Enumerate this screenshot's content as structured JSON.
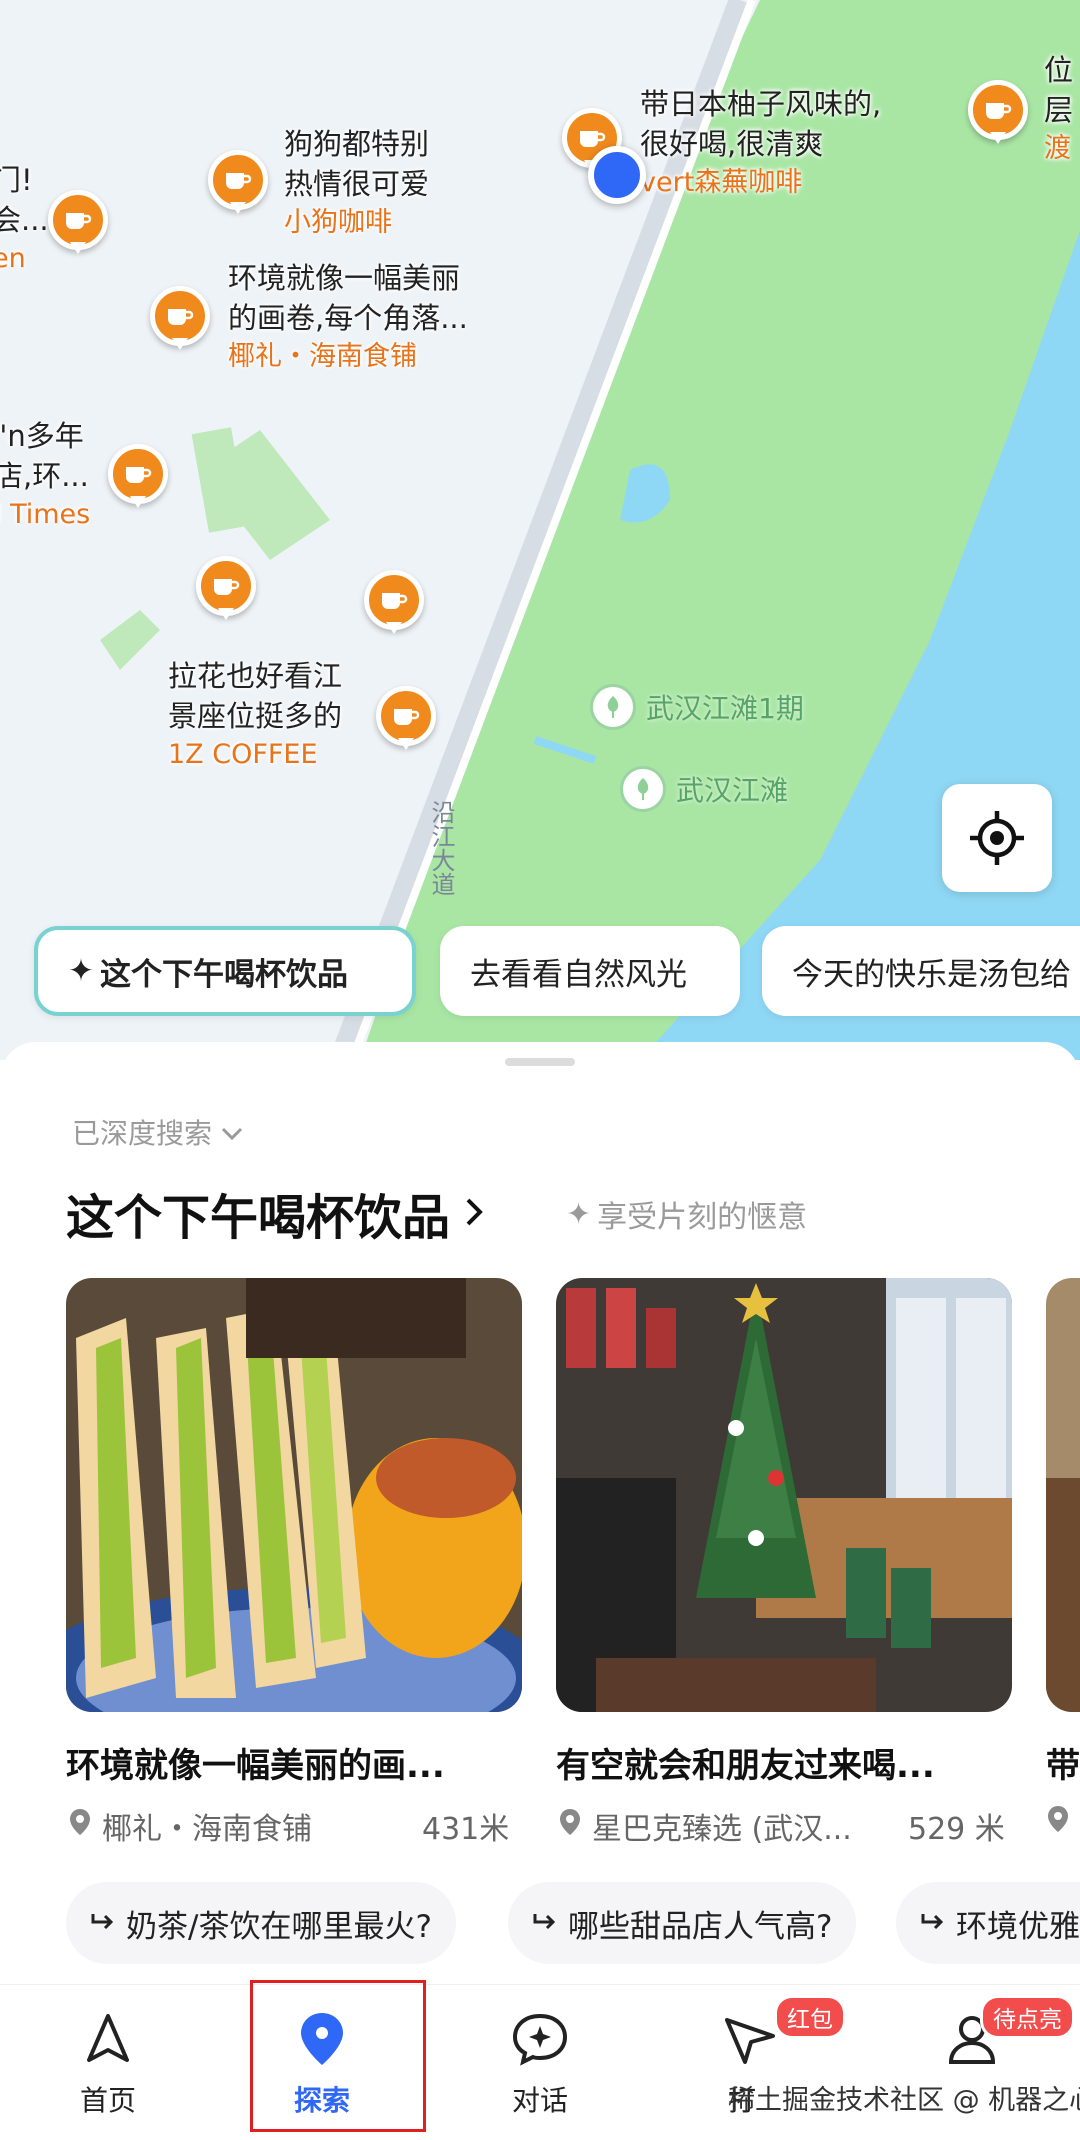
{
  "map": {
    "pois": [
      {
        "snippet": [
          "门!",
          "会..."
        ],
        "name": "en"
      },
      {
        "snippet": [
          "狗狗都特别",
          "热情很可爱"
        ],
        "name": "小狗咖啡"
      },
      {
        "snippet": [
          "带日本柚子风味的,",
          "很好喝,很清爽"
        ],
        "name": "vert森蕪咖啡"
      },
      {
        "snippet": [
          "位",
          "层"
        ],
        "name": "渡"
      },
      {
        "snippet": [
          "环境就像一幅美丽",
          "的画卷,每个角落..."
        ],
        "name": "椰礼・海南食铺"
      },
      {
        "snippet": [
          "\"n多年",
          "店,环..."
        ],
        "name": "l Times"
      },
      {
        "snippet": [
          "拉花也好看江",
          "景座位挺多的"
        ],
        "name": "1Z COFFEE"
      }
    ],
    "park_labels": [
      "武汉江滩1期",
      "武汉江滩"
    ],
    "road_label": "沿江大道",
    "chips": [
      "这个下午喝杯饮品",
      "去看看自然风光",
      "今天的快乐是汤包给"
    ]
  },
  "sheet": {
    "deep_search": "已深度搜索",
    "title": "这个下午喝杯饮品",
    "subtitle": "享受片刻的惬意",
    "cards": [
      {
        "title": "环境就像一幅美丽的画...",
        "place": "椰礼・海南食铺",
        "distance": "431米"
      },
      {
        "title": "有空就会和朋友过来喝...",
        "place": "星巴克臻选 (武汉...",
        "distance": "529 米"
      },
      {
        "title": "带",
        "place": "",
        "distance": ""
      }
    ],
    "questions": [
      "奶茶/茶饮在哪里最火?",
      "哪些甜品店人气高?",
      "环境优雅"
    ]
  },
  "nav": {
    "items": [
      {
        "label": "首页",
        "icon": "navigate-arrow-icon"
      },
      {
        "label": "探索",
        "icon": "map-pin-icon"
      },
      {
        "label": "对话",
        "icon": "chat-bubble-icon"
      },
      {
        "label": "打",
        "icon": "send-icon",
        "badge": "红包"
      },
      {
        "label": "",
        "icon": "user-icon",
        "badge": "待点亮"
      }
    ]
  },
  "watermark": "稀土掘金技术社区 @ 机器之心",
  "colors": {
    "accent_orange": "#f08a1c",
    "active_blue": "#2f67f6",
    "badge_red": "#f24c4c",
    "river": "#8fd8f5",
    "park": "#a8e6a3"
  }
}
